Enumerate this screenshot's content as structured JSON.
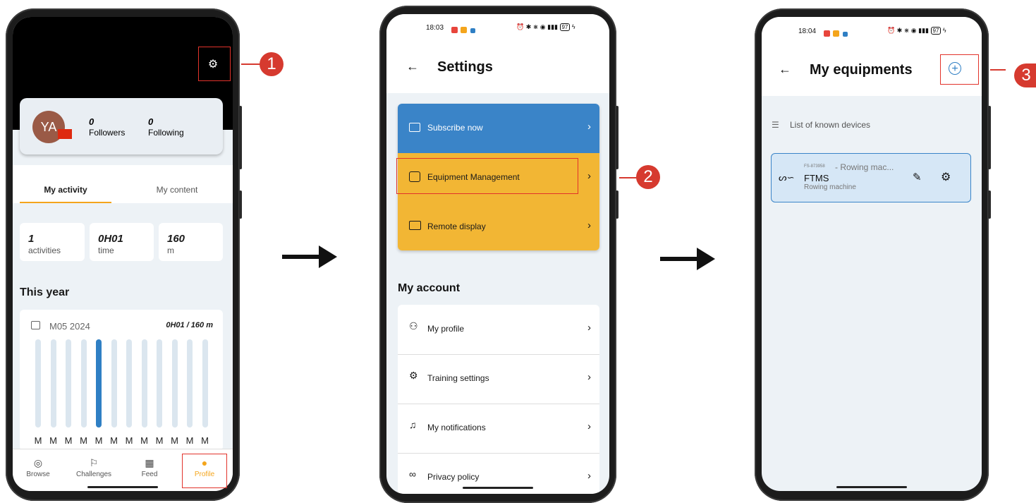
{
  "annotations": {
    "step1": "1",
    "step2": "2",
    "step3": "3"
  },
  "phone1": {
    "profile": {
      "avatar_initials": "YA",
      "followers_count": "0",
      "followers_label": "Followers",
      "following_count": "0",
      "following_label": "Following"
    },
    "tabs": [
      {
        "label": "My activity",
        "active": true
      },
      {
        "label": "My content",
        "active": false
      }
    ],
    "stats": [
      {
        "value": "1",
        "label": "activities"
      },
      {
        "value": "0H01",
        "label": "time"
      },
      {
        "value": "160",
        "label": "m"
      }
    ],
    "this_year_title": "This year",
    "chart_card": {
      "period": "M05 2024",
      "summary": "0H01 / 160 m"
    },
    "chart_data": {
      "type": "bar",
      "categories": [
        "M",
        "M",
        "M",
        "M",
        "M",
        "M",
        "M",
        "M",
        "M",
        "M",
        "M",
        "M"
      ],
      "values": [
        0,
        0,
        0,
        0,
        1,
        0,
        0,
        0,
        0,
        0,
        0,
        0
      ],
      "highlight_index": 4,
      "colors": {
        "track": "#dbe6ef",
        "active": "#2f7fc4"
      }
    },
    "bottom_nav": [
      {
        "label": "Browse",
        "icon": "compass-icon",
        "active": false
      },
      {
        "label": "Challenges",
        "icon": "flag-icon",
        "active": false
      },
      {
        "label": "Feed",
        "icon": "grid-icon",
        "active": false
      },
      {
        "label": "Profile",
        "icon": "person-icon",
        "active": true
      }
    ]
  },
  "phone2": {
    "status": {
      "time": "18:03",
      "battery": "97"
    },
    "title": "Settings",
    "top_items": [
      {
        "label": "Subscribe now",
        "icon": "card-icon",
        "color": "#3a84c8"
      },
      {
        "label": "Equipment Management",
        "icon": "box-check-icon",
        "color": "#f2b634"
      },
      {
        "label": "Remote display",
        "icon": "monitor-icon",
        "color": "#f2b634"
      }
    ],
    "account_title": "My account",
    "account_items": [
      {
        "label": "My profile",
        "icon": "user-icon"
      },
      {
        "label": "Training settings",
        "icon": "gear-icon"
      },
      {
        "label": "My notifications",
        "icon": "bell-icon"
      },
      {
        "label": "Privacy policy",
        "icon": "glasses-icon"
      }
    ]
  },
  "phone3": {
    "status": {
      "time": "18:04",
      "battery": "97"
    },
    "title": "My equipments",
    "list_header": "List of known devices",
    "device": {
      "id": "FS-873958",
      "model_truncated": "- Rowing mac...",
      "name": "FTMS",
      "type": "Rowing machine"
    }
  },
  "colors": {
    "accent_blue": "#2f7fc4",
    "accent_yellow": "#f2b634",
    "annotation_red": "#d63a2f",
    "profile_orange": "#f4a51c"
  }
}
